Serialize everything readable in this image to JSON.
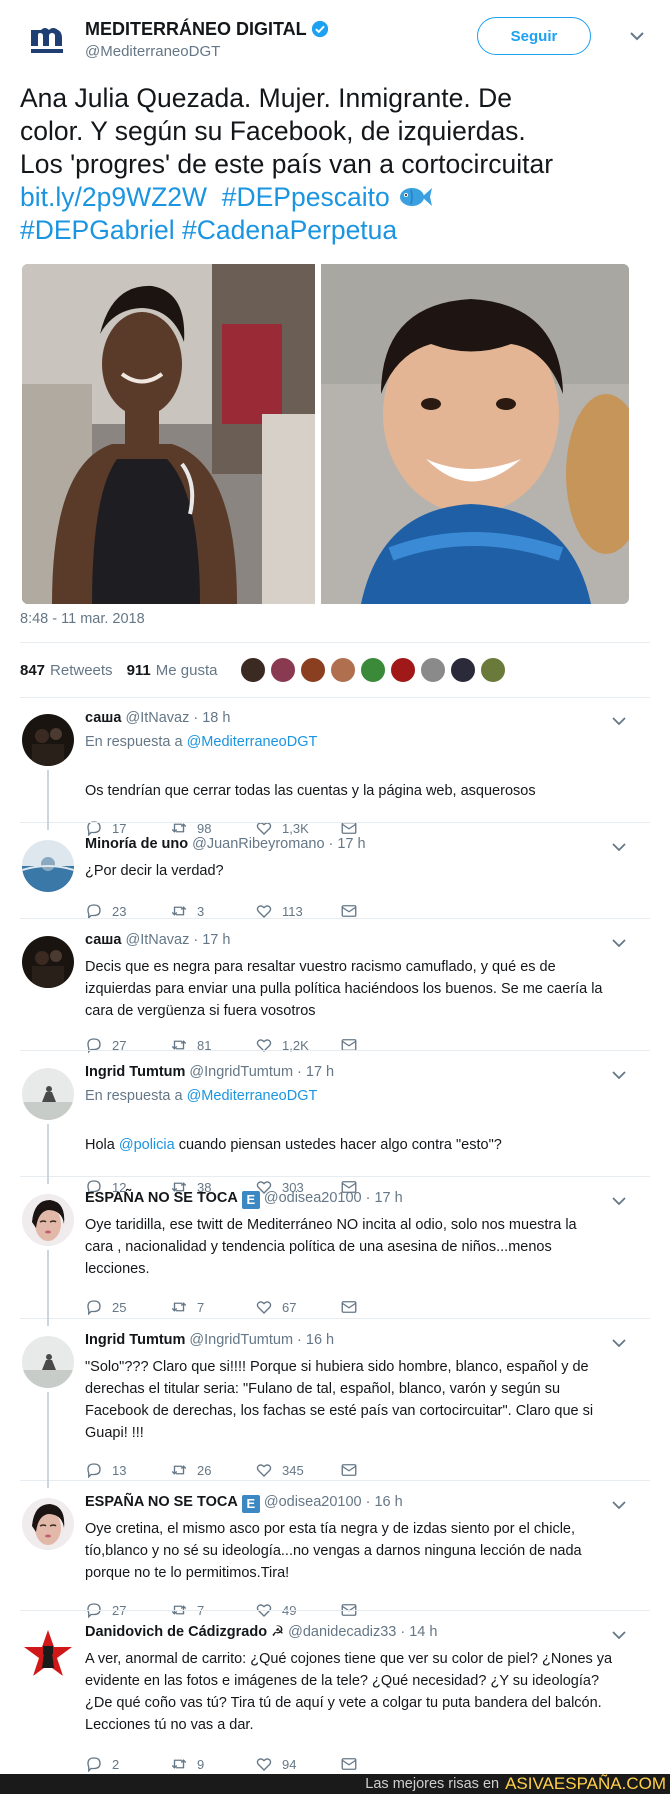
{
  "tweet": {
    "account_name": "MEDITERRÁNEO DIGITAL",
    "account_handle": "@MediterraneoDGT",
    "follow_label": "Seguir",
    "text_lines": [
      "Ana Julia Quezada. Mujer. Inmigrante. De",
      "color. Y según su Facebook, de izquierdas.",
      "Los 'progres' de este país van a cortocircuitar"
    ],
    "link": "bit.ly/2p9WZ2W",
    "hashtags": [
      "#DEPpescaito",
      "#DEPGabriel",
      "#CadenaPerpetua"
    ],
    "timestamp": "8:48 - 11 mar. 2018",
    "retweets_count": "847",
    "retweets_label": "Retweets",
    "likes_count": "911",
    "likes_label": "Me gusta",
    "liker_colors": [
      "#3a2a22",
      "#8a3a50",
      "#8a4020",
      "#b07050",
      "#3a8a3a",
      "#a01818",
      "#8a8a8a",
      "#2a2a3a",
      "#6a7a3a"
    ]
  },
  "replies": [
    {
      "name": "саша",
      "handle": "@ItNavaz",
      "time": "18 h",
      "in_reply_prefix": "En respuesta a",
      "in_reply_to": "@MediterraneoDGT",
      "lines": [
        "Os tendrían que cerrar todas las cuentas y la página web, asquerosos"
      ],
      "replies": "17",
      "retweets": "98",
      "likes": "1,3K"
    },
    {
      "name": "Minoría de uno",
      "handle": "@JuanRibeyromano",
      "time": "17 h",
      "lines": [
        "¿Por decir la verdad?"
      ],
      "replies": "23",
      "retweets": "3",
      "likes": "113"
    },
    {
      "name": "саша",
      "handle": "@ItNavaz",
      "time": "17 h",
      "lines": [
        "Decis que es negra para resaltar vuestro racismo camuflado, y qué es de",
        "izquierdas para enviar una pulla política haciéndoos los buenos. Se me caería la",
        "cara de vergüenza si fuera vosotros"
      ],
      "replies": "27",
      "retweets": "81",
      "likes": "1,2K"
    },
    {
      "name": "Ingrid Tumtum",
      "handle": "@IngridTumtum",
      "time": "17 h",
      "in_reply_prefix": "En respuesta a",
      "in_reply_to": "@MediterraneoDGT",
      "lines_pre": "Hola",
      "lines_mention": "@policia",
      "lines_post": "cuando piensan ustedes hacer algo contra \"esto\"?",
      "replies": "12",
      "retweets": "38",
      "likes": "303"
    },
    {
      "name": "ESPAÑA NO SE TOCA",
      "badge": "E",
      "handle": "@odisea20100",
      "time": "17 h",
      "lines": [
        "Oye taridilla, ese twitt de Mediterráneo NO incita al odio, solo nos muestra la",
        "cara , nacionalidad y tendencia política de una asesina de niños...menos",
        "lecciones."
      ],
      "replies": "25",
      "retweets": "7",
      "likes": "67"
    },
    {
      "name": "Ingrid Tumtum",
      "handle": "@IngridTumtum",
      "time": "16 h",
      "lines": [
        "\"Solo\"??? Claro que si!!!! Porque si hubiera sido hombre, blanco, español y de",
        "derechas el titular seria: \"Fulano de tal, español,  blanco, varón y según su",
        "Facebook de derechas,  los fachas se esté país van  cortocircuitar\". Claro que si",
        "Guapi! !!!"
      ],
      "replies": "13",
      "retweets": "26",
      "likes": "345"
    },
    {
      "name": "ESPAÑA NO SE TOCA",
      "badge": "E",
      "handle": "@odisea20100",
      "time": "16 h",
      "lines": [
        "Oye cretina, el mismo asco por esta tía negra y de izdas siento por el chicle,",
        "tío,blanco y no sé su ideología...no vengas a darnos ninguna lección de nada",
        "porque no te lo permitimos.Tira!"
      ],
      "replies": "27",
      "retweets": "7",
      "likes": "49"
    },
    {
      "name": "Danidovich de Cádizgrado",
      "symbol": "☭",
      "handle": "@danidecadiz33",
      "time": "14 h",
      "lines": [
        "A ver, anormal de carrito: ¿Qué cojones tiene que ver su color de piel? ¿Nones ya",
        "evidente en las fotos e imágenes de la tele? ¿Qué necesidad? ¿Y su ideología?",
        "¿De qué coño vas tú? Tira tú de aquí y vete a colgar tu puta bandera del balcón.",
        "Lecciones tú no vas a dar."
      ],
      "replies": "2",
      "retweets": "9",
      "likes": "94"
    }
  ],
  "footer": {
    "text": "Las mejores risas en",
    "brand": "ASIVAESPAÑA.COM"
  }
}
